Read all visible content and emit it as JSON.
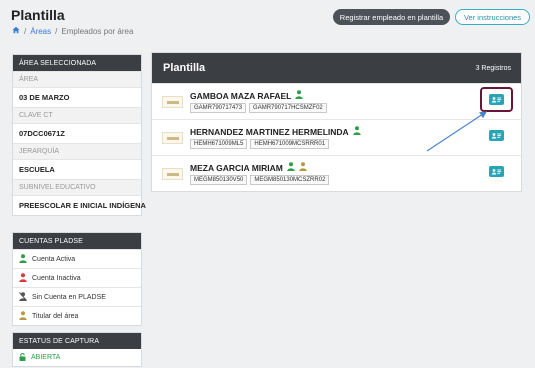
{
  "header": {
    "title": "Plantilla",
    "breadcrumb": {
      "home_icon": "home-icon",
      "areas": "Áreas",
      "separator": "/",
      "current": "Empleados por área"
    },
    "register_button": "Registrar empleado en plantilla",
    "instructions_button": "Ver instrucciones"
  },
  "area": {
    "heading": "ÁREA SELECCIONADA",
    "fields": [
      {
        "label": "ÁREA",
        "value": "03 DE MARZO"
      },
      {
        "label": "CLAVE CT",
        "value": "07DCC0671Z"
      },
      {
        "label": "JERARQUÍA",
        "value": "ESCUELA"
      },
      {
        "label": "SUBNIVEL EDUCATIVO",
        "value": "PREESCOLAR E INICIAL INDÍGENA"
      }
    ]
  },
  "accounts": {
    "heading": "CUENTAS PLADSE",
    "items": [
      {
        "label": "Cuenta Activa",
        "icon": "user-active-icon",
        "color": "#2e9e48"
      },
      {
        "label": "Cuenta Inactiva",
        "icon": "user-inactive-icon",
        "color": "#d63a3a"
      },
      {
        "label": "Sin Cuenta en PLADSE",
        "icon": "user-no-account-icon",
        "color": "#555555"
      },
      {
        "label": "Titular del área",
        "icon": "user-head-icon",
        "color": "#b89a3c"
      }
    ]
  },
  "capture": {
    "heading": "ESTATUS DE CAPTURA",
    "status": "ABIERTA",
    "color": "#2e9e48"
  },
  "roster": {
    "title": "Plantilla",
    "count": "3 Registros",
    "employees": [
      {
        "name": "GAMBOA MAZA RAFAEL",
        "rfc": "GAMR790717473",
        "curp": "GAMR790717HCSMZF02",
        "icons": [
          "user-active-icon"
        ]
      },
      {
        "name": "HERNANDEZ MARTINEZ HERMELINDA",
        "rfc": "HEMH671009ML5",
        "curp": "HEMH671009MCSRRR01",
        "icons": [
          "user-active-icon"
        ]
      },
      {
        "name": "MEZA GARCIA MIRIAM",
        "rfc": "MEGM850130V50",
        "curp": "MEGM850130MCSZRR02",
        "icons": [
          "user-active-icon",
          "user-head-icon"
        ]
      }
    ]
  }
}
